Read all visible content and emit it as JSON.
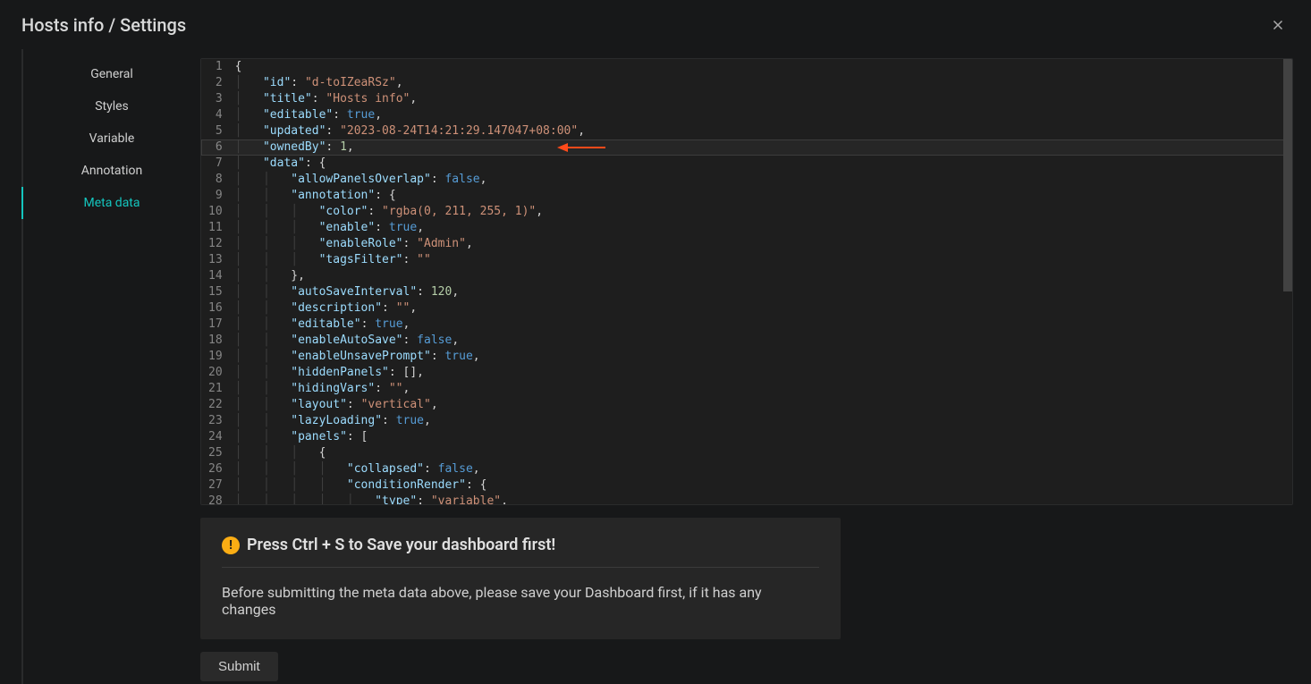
{
  "header": {
    "title": "Hosts info / Settings"
  },
  "tabs": {
    "general": "General",
    "styles": "Styles",
    "variable": "Variable",
    "annotation": "Annotation",
    "metadata": "Meta data"
  },
  "editor": {
    "line_count": 28,
    "tokens": [
      [
        {
          "cls": "punct",
          "t": "{"
        }
      ],
      [
        {
          "cls": "ind",
          "n": 1
        },
        {
          "cls": "key",
          "t": "\"id\""
        },
        {
          "cls": "punct",
          "t": ": "
        },
        {
          "cls": "str",
          "t": "\"d-toIZeaRSz\""
        },
        {
          "cls": "punct",
          "t": ","
        }
      ],
      [
        {
          "cls": "ind",
          "n": 1
        },
        {
          "cls": "key",
          "t": "\"title\""
        },
        {
          "cls": "punct",
          "t": ": "
        },
        {
          "cls": "str",
          "t": "\"Hosts info\""
        },
        {
          "cls": "punct",
          "t": ","
        }
      ],
      [
        {
          "cls": "ind",
          "n": 1
        },
        {
          "cls": "key",
          "t": "\"editable\""
        },
        {
          "cls": "punct",
          "t": ": "
        },
        {
          "cls": "kw",
          "t": "true"
        },
        {
          "cls": "punct",
          "t": ","
        }
      ],
      [
        {
          "cls": "ind",
          "n": 1
        },
        {
          "cls": "key",
          "t": "\"updated\""
        },
        {
          "cls": "punct",
          "t": ": "
        },
        {
          "cls": "str",
          "t": "\"2023-08-24T14:21:29.147047+08:00\""
        },
        {
          "cls": "punct",
          "t": ","
        }
      ],
      [
        {
          "cls": "ind",
          "n": 1
        },
        {
          "cls": "key",
          "t": "\"ownedBy\""
        },
        {
          "cls": "punct",
          "t": ": "
        },
        {
          "cls": "num",
          "t": "1"
        },
        {
          "cls": "punct",
          "t": ","
        }
      ],
      [
        {
          "cls": "ind",
          "n": 1
        },
        {
          "cls": "key",
          "t": "\"data\""
        },
        {
          "cls": "punct",
          "t": ": {"
        }
      ],
      [
        {
          "cls": "ind",
          "n": 2
        },
        {
          "cls": "key",
          "t": "\"allowPanelsOverlap\""
        },
        {
          "cls": "punct",
          "t": ": "
        },
        {
          "cls": "kw",
          "t": "false"
        },
        {
          "cls": "punct",
          "t": ","
        }
      ],
      [
        {
          "cls": "ind",
          "n": 2
        },
        {
          "cls": "key",
          "t": "\"annotation\""
        },
        {
          "cls": "punct",
          "t": ": {"
        }
      ],
      [
        {
          "cls": "ind",
          "n": 3
        },
        {
          "cls": "key",
          "t": "\"color\""
        },
        {
          "cls": "punct",
          "t": ": "
        },
        {
          "cls": "str",
          "t": "\"rgba(0, 211, 255, 1)\""
        },
        {
          "cls": "punct",
          "t": ","
        }
      ],
      [
        {
          "cls": "ind",
          "n": 3
        },
        {
          "cls": "key",
          "t": "\"enable\""
        },
        {
          "cls": "punct",
          "t": ": "
        },
        {
          "cls": "kw",
          "t": "true"
        },
        {
          "cls": "punct",
          "t": ","
        }
      ],
      [
        {
          "cls": "ind",
          "n": 3
        },
        {
          "cls": "key",
          "t": "\"enableRole\""
        },
        {
          "cls": "punct",
          "t": ": "
        },
        {
          "cls": "str",
          "t": "\"Admin\""
        },
        {
          "cls": "punct",
          "t": ","
        }
      ],
      [
        {
          "cls": "ind",
          "n": 3
        },
        {
          "cls": "key",
          "t": "\"tagsFilter\""
        },
        {
          "cls": "punct",
          "t": ": "
        },
        {
          "cls": "str",
          "t": "\"\""
        }
      ],
      [
        {
          "cls": "ind",
          "n": 2
        },
        {
          "cls": "punct",
          "t": "},"
        }
      ],
      [
        {
          "cls": "ind",
          "n": 2
        },
        {
          "cls": "key",
          "t": "\"autoSaveInterval\""
        },
        {
          "cls": "punct",
          "t": ": "
        },
        {
          "cls": "num",
          "t": "120"
        },
        {
          "cls": "punct",
          "t": ","
        }
      ],
      [
        {
          "cls": "ind",
          "n": 2
        },
        {
          "cls": "key",
          "t": "\"description\""
        },
        {
          "cls": "punct",
          "t": ": "
        },
        {
          "cls": "str",
          "t": "\"\""
        },
        {
          "cls": "punct",
          "t": ","
        }
      ],
      [
        {
          "cls": "ind",
          "n": 2
        },
        {
          "cls": "key",
          "t": "\"editable\""
        },
        {
          "cls": "punct",
          "t": ": "
        },
        {
          "cls": "kw",
          "t": "true"
        },
        {
          "cls": "punct",
          "t": ","
        }
      ],
      [
        {
          "cls": "ind",
          "n": 2
        },
        {
          "cls": "key",
          "t": "\"enableAutoSave\""
        },
        {
          "cls": "punct",
          "t": ": "
        },
        {
          "cls": "kw",
          "t": "false"
        },
        {
          "cls": "punct",
          "t": ","
        }
      ],
      [
        {
          "cls": "ind",
          "n": 2
        },
        {
          "cls": "key",
          "t": "\"enableUnsavePrompt\""
        },
        {
          "cls": "punct",
          "t": ": "
        },
        {
          "cls": "kw",
          "t": "true"
        },
        {
          "cls": "punct",
          "t": ","
        }
      ],
      [
        {
          "cls": "ind",
          "n": 2
        },
        {
          "cls": "key",
          "t": "\"hiddenPanels\""
        },
        {
          "cls": "punct",
          "t": ": [],"
        }
      ],
      [
        {
          "cls": "ind",
          "n": 2
        },
        {
          "cls": "key",
          "t": "\"hidingVars\""
        },
        {
          "cls": "punct",
          "t": ": "
        },
        {
          "cls": "str",
          "t": "\"\""
        },
        {
          "cls": "punct",
          "t": ","
        }
      ],
      [
        {
          "cls": "ind",
          "n": 2
        },
        {
          "cls": "key",
          "t": "\"layout\""
        },
        {
          "cls": "punct",
          "t": ": "
        },
        {
          "cls": "str",
          "t": "\"vertical\""
        },
        {
          "cls": "punct",
          "t": ","
        }
      ],
      [
        {
          "cls": "ind",
          "n": 2
        },
        {
          "cls": "key",
          "t": "\"lazyLoading\""
        },
        {
          "cls": "punct",
          "t": ": "
        },
        {
          "cls": "kw",
          "t": "true"
        },
        {
          "cls": "punct",
          "t": ","
        }
      ],
      [
        {
          "cls": "ind",
          "n": 2
        },
        {
          "cls": "key",
          "t": "\"panels\""
        },
        {
          "cls": "punct",
          "t": ": ["
        }
      ],
      [
        {
          "cls": "ind",
          "n": 3
        },
        {
          "cls": "punct",
          "t": "{"
        }
      ],
      [
        {
          "cls": "ind",
          "n": 4
        },
        {
          "cls": "key",
          "t": "\"collapsed\""
        },
        {
          "cls": "punct",
          "t": ": "
        },
        {
          "cls": "kw",
          "t": "false"
        },
        {
          "cls": "punct",
          "t": ","
        }
      ],
      [
        {
          "cls": "ind",
          "n": 4
        },
        {
          "cls": "key",
          "t": "\"conditionRender\""
        },
        {
          "cls": "punct",
          "t": ": {"
        }
      ],
      [
        {
          "cls": "ind",
          "n": 5
        },
        {
          "cls": "key",
          "t": "\"type\""
        },
        {
          "cls": "punct",
          "t": ": "
        },
        {
          "cls": "str",
          "t": "\"variable\""
        },
        {
          "cls": "punct",
          "t": ","
        }
      ]
    ]
  },
  "alert": {
    "title": "Press Ctrl + S to Save your dashboard first!",
    "body": "Before submitting the meta data above, please save your Dashboard first, if it has any changes"
  },
  "buttons": {
    "submit": "Submit"
  }
}
